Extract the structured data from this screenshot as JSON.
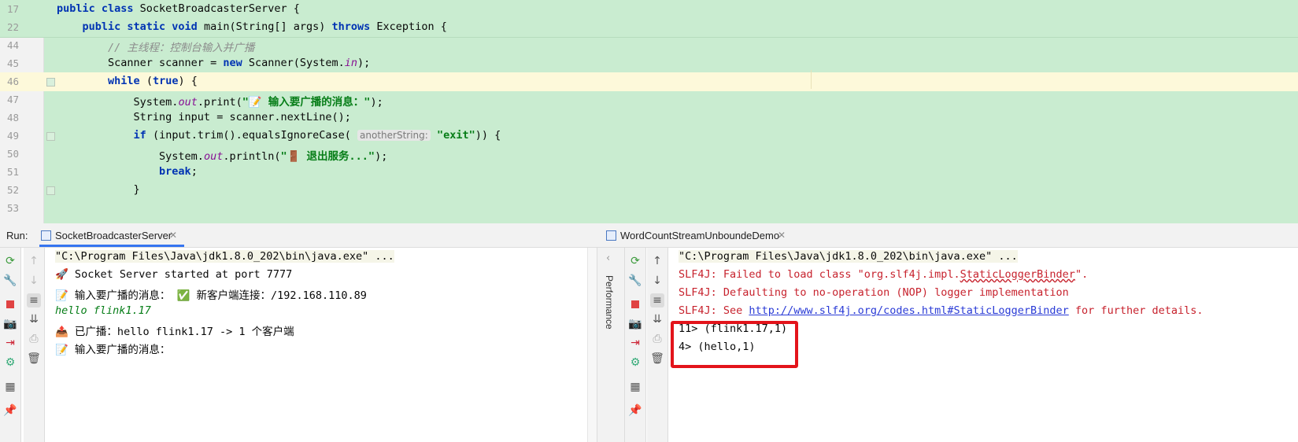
{
  "editor": {
    "lines": [
      {
        "num": "17",
        "tokens": [
          [
            "kw",
            "public class "
          ],
          [
            "",
            "SocketBroadcasterServer {"
          ]
        ]
      },
      {
        "num": "22",
        "tokens": [
          [
            "",
            "    "
          ],
          [
            "kw",
            "public static void "
          ],
          [
            "",
            "main(String[] args) "
          ],
          [
            "kw",
            "throws "
          ],
          [
            "",
            "Exception {"
          ]
        ]
      },
      {
        "num": "44",
        "tokens": [
          [
            "",
            "        "
          ],
          [
            "cm",
            "// 主线程：控制台输入并广播"
          ]
        ]
      },
      {
        "num": "45",
        "tokens": [
          [
            "",
            "        Scanner scanner = "
          ],
          [
            "kw",
            "new "
          ],
          [
            "",
            "Scanner(System."
          ],
          [
            "fld",
            "in"
          ],
          [
            "",
            ");"
          ]
        ]
      },
      {
        "num": "46",
        "tokens": [
          [
            "",
            "        "
          ],
          [
            "kw",
            "while "
          ],
          [
            "",
            "("
          ],
          [
            "kw",
            "true"
          ],
          [
            "",
            ") {"
          ]
        ]
      },
      {
        "num": "47",
        "tokens": [
          [
            "",
            "            System."
          ],
          [
            "fld",
            "out"
          ],
          [
            "",
            ".print("
          ],
          [
            "st",
            "\"📝 输入要广播的消息：\""
          ],
          [
            "",
            ");"
          ]
        ]
      },
      {
        "num": "48",
        "tokens": [
          [
            "",
            "            String input = scanner.nextLine();"
          ]
        ]
      },
      {
        "num": "49",
        "tokens": [
          [
            "",
            "            "
          ],
          [
            "kw",
            "if "
          ],
          [
            "",
            "(input.trim().equalsIgnoreCase( "
          ],
          [
            "hint",
            "anotherString:"
          ],
          [
            "st",
            " \"exit\""
          ],
          [
            "",
            ")) {"
          ]
        ]
      },
      {
        "num": "50",
        "tokens": [
          [
            "",
            "                System."
          ],
          [
            "fld",
            "out"
          ],
          [
            "",
            ".println("
          ],
          [
            "st",
            "\"🚪 退出服务...\""
          ],
          [
            "",
            ");"
          ]
        ]
      },
      {
        "num": "51",
        "tokens": [
          [
            "",
            "                "
          ],
          [
            "kw",
            "break"
          ],
          [
            "",
            ";"
          ]
        ]
      },
      {
        "num": "52",
        "tokens": [
          [
            "",
            "            }"
          ]
        ]
      },
      {
        "num": "53",
        "tokens": [
          [
            "",
            ""
          ]
        ]
      }
    ]
  },
  "run": {
    "label": "Run:",
    "left_tab": "SocketBroadcasterServer",
    "right_tab": "WordCountStreamUnboundeDemo",
    "performance_label": "Performance"
  },
  "left_console": {
    "line1": "\"C:\\Program Files\\Java\\jdk1.8.0_202\\bin\\java.exe\" ...",
    "line2": "🚀 Socket Server started at port 7777",
    "line3a": "📝 输入要广播的消息：",
    "line3b": "✅ 新客户端连接：/192.168.110.89",
    "line4": "hello flink1.17",
    "line5": "📤 已广播：hello flink1.17 -> 1 个客户端",
    "line6": "📝 输入要广播的消息："
  },
  "right_console": {
    "line1": "\"C:\\Program Files\\Java\\jdk1.8.0_202\\bin\\java.exe\" ...",
    "line2a": "SLF4J: Failed to load class \"org.slf4j.impl.",
    "line2b": "StaticLoggerBinder",
    "line2c": "\".",
    "line3": "SLF4J: Defaulting to no-operation (NOP) logger implementation",
    "line4a": "SLF4J: See ",
    "line4b": "http://www.slf4j.org/codes.html#StaticLoggerBinder",
    "line4c": " for further details.",
    "line5": "11> (flink1.17,1)",
    "line6": "4> (hello,1)"
  },
  "toolbar_icons": [
    "rerun-icon",
    "wrench-icon",
    "stop-icon",
    "camera-icon",
    "login-icon",
    "debug-icon",
    "layout-icon",
    "pin-icon",
    "up-arrow-icon",
    "down-arrow-icon",
    "wrap-icon",
    "scroll-end-icon",
    "print-icon",
    "trash-icon"
  ],
  "colors": {
    "editor_bg": "#c9ecd0",
    "keyword": "#0033b3",
    "string": "#067d17",
    "error": "#c7222d",
    "highlight_box": "#e3141b"
  }
}
